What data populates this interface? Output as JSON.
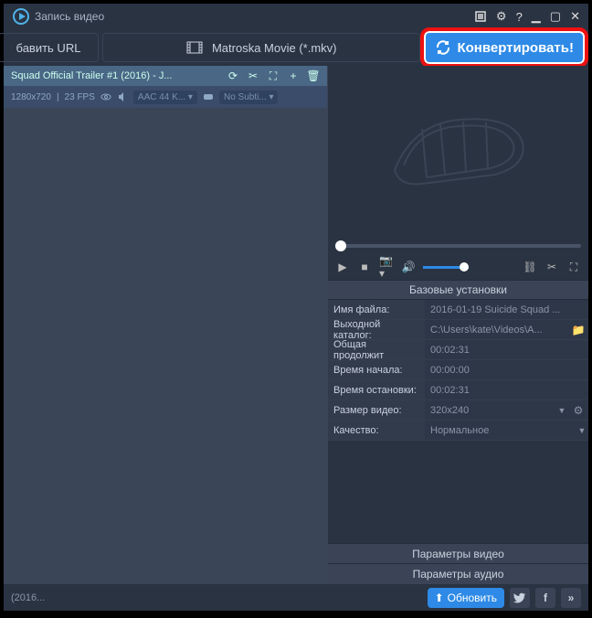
{
  "titlebar": {
    "title": "Запись видео"
  },
  "toolbar": {
    "add_url": "бавить URL",
    "format": "Matroska Movie (*.mkv)",
    "convert": "Конвертировать!"
  },
  "file": {
    "title": "Squad Official Trailer #1 (2016) - J...",
    "resolution": "1280x720",
    "fps": "23 FPS",
    "audio": "AAC 44 K...",
    "subs": "No Subti..."
  },
  "settings": {
    "header": "Базовые установки",
    "props": [
      {
        "label": "Имя файла:",
        "value": "2016-01-19 Suicide Squad ..."
      },
      {
        "label": "Выходной каталог:",
        "value": "C:\\Users\\kate\\Videos\\A..."
      },
      {
        "label": "Общая продолжит",
        "value": "00:02:31"
      },
      {
        "label": "Время начала:",
        "value": "00:00:00"
      },
      {
        "label": "Время остановки:",
        "value": "00:02:31"
      },
      {
        "label": "Размер видео:",
        "value": "320x240"
      },
      {
        "label": "Качество:",
        "value": "Нормальное"
      }
    ],
    "video_params": "Параметры видео",
    "audio_params": "Параметры аудио"
  },
  "bottombar": {
    "status": "(2016...",
    "upload": "Обновить"
  }
}
